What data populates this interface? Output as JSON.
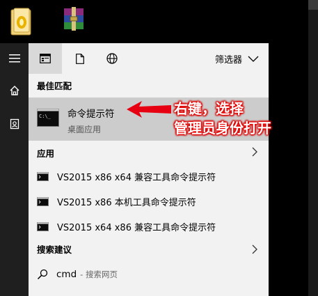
{
  "desktop": {
    "icons": [
      {
        "name": "folder-icon",
        "color": "#e8c35a"
      },
      {
        "name": "winrar-archive-icon",
        "color": "#7a1f6e"
      }
    ]
  },
  "rail": {
    "items": [
      {
        "name": "hamburger-menu-icon"
      },
      {
        "name": "home-icon"
      },
      {
        "name": "documents-icon"
      }
    ]
  },
  "topbar": {
    "tabs": [
      {
        "name": "apps-tab-icon",
        "selected": true
      },
      {
        "name": "documents-tab-icon",
        "selected": false
      },
      {
        "name": "web-tab-icon",
        "selected": false
      }
    ],
    "filter_label": "筛选器"
  },
  "best_match": {
    "section_title": "最佳匹配",
    "name": "命令提示符",
    "subtitle": "桌面应用"
  },
  "apps": {
    "section_title": "应用",
    "items": [
      {
        "label": "VS2015 x86 x64 兼容工具命令提示符"
      },
      {
        "label": "VS2015 x86 本机工具命令提示符"
      },
      {
        "label": "VS2015 x64 x86 兼容工具命令提示符"
      }
    ]
  },
  "suggestions": {
    "section_title": "搜索建议",
    "query": "cmd",
    "hint": "- 搜索网页"
  },
  "annotation": {
    "line1": "右键，选择",
    "line2": "管理员身份打开",
    "color": "#e60012"
  },
  "colors": {
    "panel_bg": "#f2f2f2",
    "rail_bg": "#1f1f1f",
    "selected_bg": "#cccccc"
  }
}
